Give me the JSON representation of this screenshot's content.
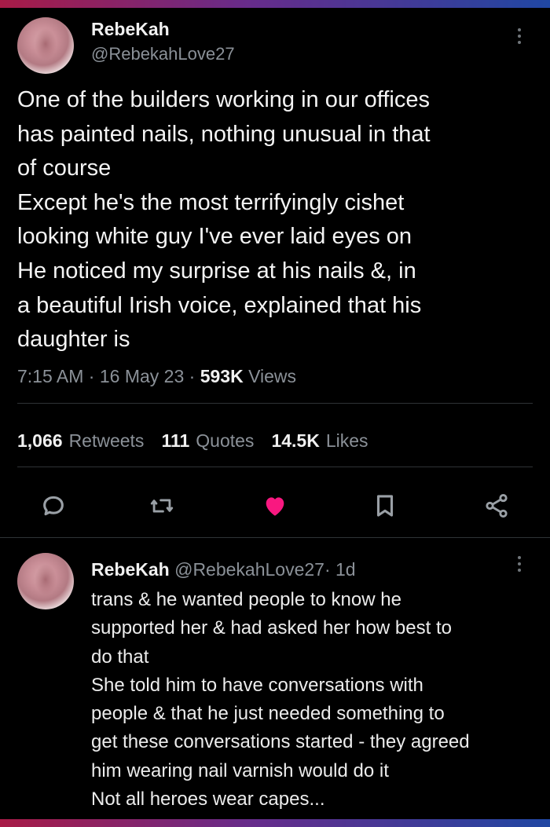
{
  "tweet": {
    "author_name": "RebeKah",
    "author_handle": "@RebekahLove27",
    "text": "One of the builders working in our offices\nhas painted nails, nothing unusual in that\nof course\nExcept he's the most terrifyingly cishet\nlooking white guy I've ever laid eyes on\nHe noticed my surprise at his nails &, in\na beautiful Irish voice, explained that his\ndaughter is",
    "time": "7:15 AM",
    "date": "16 May 23",
    "views_count": "593K",
    "views_label": "Views",
    "separator": " · "
  },
  "stats": {
    "retweets_count": "1,066",
    "retweets_label": "Retweets",
    "quotes_count": "111",
    "quotes_label": "Quotes",
    "likes_count": "14.5K",
    "likes_label": "Likes"
  },
  "actions": {
    "reply_icon": "speech-bubble",
    "retweet_icon": "retweet-arrows",
    "like_icon": "heart-filled",
    "bookmark_icon": "bookmark",
    "share_icon": "share-nodes",
    "like_color": "#f91880"
  },
  "reply": {
    "author_name": "RebeKah",
    "author_handle": "@RebekahLove27",
    "age": "· 1d",
    "text": "trans & he wanted people to know he\nsupported her & had asked her how best to\ndo that\nShe told him to have conversations with\npeople & that he just needed something to\nget these conversations started - they agreed\nhim wearing nail varnish would do it\nNot all heroes wear capes..."
  }
}
